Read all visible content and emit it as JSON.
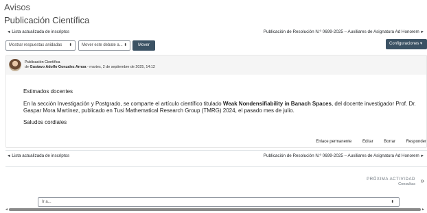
{
  "page": {
    "title": "Avisos",
    "forum_name": "Publicación Científica"
  },
  "nav": {
    "prev_arrow": "◄",
    "prev_label": "Lista actualizada de inscriptos",
    "next_label": "Publicación de Resolución N.º 0699-2025 – Auxiliares de Asignatura Ad Honorem",
    "next_arrow": "►"
  },
  "toolbar": {
    "display_mode": "Mostrar respuestas anidadas",
    "move_select": "Mover este debate a...",
    "move_button": "Mover",
    "settings_button": "Configuraciones",
    "chevron": "▾"
  },
  "post": {
    "subject": "Publicación Científica",
    "by_prefix": "de",
    "author": "Gustavo Adolfo Gonzalez Arnoa",
    "date": "- martes, 2 de septiembre de 2025, 14:12",
    "greeting": "Estimados docentes",
    "body_before": "En la sección Investigación y Postgrado, se comparte el artículo científico titulado ",
    "body_bold": "Weak Nondensifiability in Banach Spaces",
    "body_after": ", del docente investigador Prof. Dr. Gaspar Mora Martínez, publicado en Tusi Mathematical Research Group (TMRG) 2024, el pasado mes de julio.",
    "closing": "Saludos cordiales",
    "actions": {
      "permalink": "Enlace permanente",
      "edit": "Editar",
      "delete": "Borrar",
      "reply": "Responder"
    }
  },
  "next_activity": {
    "label": "PRÓXIMA ACTIVIDAD",
    "name": "Consultas",
    "chevron": "»"
  },
  "jump": {
    "placeholder": "Ir a...",
    "chevron": "⬍"
  },
  "scrollbar": {
    "left_arrow": "◄",
    "right_arrow": "►"
  }
}
